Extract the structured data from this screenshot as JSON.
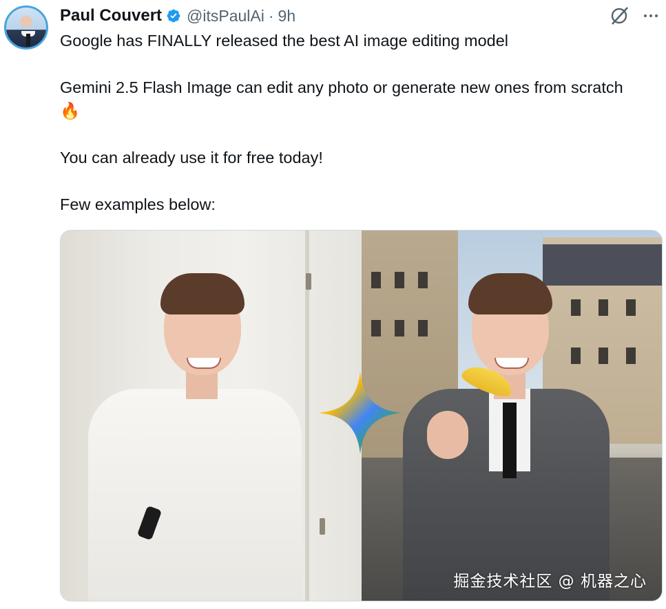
{
  "author": {
    "name": "Paul Couvert",
    "handle": "@itsPaulAi",
    "separator": "·",
    "time": "9h"
  },
  "icons": {
    "verified": "verified-badge-icon",
    "grok": "grok-icon",
    "more": "more-options-icon"
  },
  "tweet": {
    "line1": "Google has FINALLY released the best AI image editing model",
    "line2": "Gemini 2.5 Flash Image can edit any photo or generate new ones from scratch 🔥",
    "line3": "You can already use it for free today!",
    "line4": "Few examples below:"
  },
  "media": {
    "watermark": "掘金技术社区 @ 机器之心"
  },
  "colors": {
    "verified": "#1d9bf0",
    "text_primary": "#0f1419",
    "text_secondary": "#536471"
  }
}
